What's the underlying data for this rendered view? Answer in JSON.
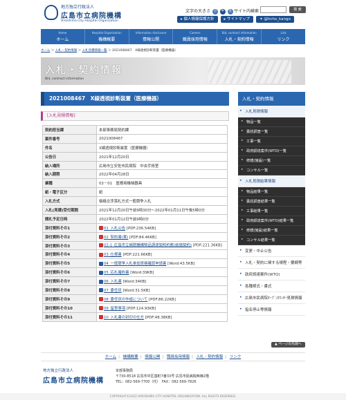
{
  "header": {
    "logo_line1": "地方独立行政法人",
    "logo_line2": "広島市立病院機構",
    "logo_line3": "Hiroshima City Hospital Organization",
    "font_size_label": "文字の大きさ",
    "font_sizes": [
      "小",
      "中",
      "大"
    ],
    "site_search_label": "サイト内検索",
    "search_button": "検 索",
    "buttons": [
      "個人情報保護方針",
      "サイトマップ",
      "@hcho_kango"
    ]
  },
  "gnav": [
    {
      "en": "Home",
      "jp": "ホーム"
    },
    {
      "en": "Hospital Organization",
      "jp": "機構概要"
    },
    {
      "en": "Information disclosure",
      "jp": "情報公開"
    },
    {
      "en": "Careers",
      "jp": "職員採用情報"
    },
    {
      "en": "Bid, contract information",
      "jp": "入札・契約情報"
    },
    {
      "en": "Link",
      "jp": "リンク"
    }
  ],
  "breadcrumb": {
    "items": [
      "ホーム",
      "入札・契約情報",
      "入札見積情報一覧"
    ],
    "current": "2021008467　X線透視診断装置（医療機器）"
  },
  "banner": {
    "title": "入札・契約情報",
    "subtitle": "Bid, contract information"
  },
  "page_title": "2021008467　X線透視診断装置（医療機器）",
  "section_title": "[入札見積情報]",
  "details": [
    {
      "key": "契約担当課",
      "value": "本部事務局契約課"
    },
    {
      "key": "案件番号",
      "value": "2021008467"
    },
    {
      "key": "件名",
      "value": "X線透視診断装置（医療機器）"
    },
    {
      "key": "公告日",
      "value": "2021年12月20日"
    },
    {
      "key": "納入場所",
      "value": "広島市立安佐市民病院　中央手術室"
    },
    {
      "key": "納入期限",
      "value": "2022年04月28日"
    },
    {
      "key": "業種",
      "value": "03－01　医療用機械器具"
    },
    {
      "key": "紙・電子区分",
      "value": "紙"
    },
    {
      "key": "入札方式",
      "value": "価格交渉落札方式一般競争入札"
    },
    {
      "key": "入札(見積)受付期間",
      "value": "2021年12月20日午前9時30分～2022年01月11日午後5時0分"
    },
    {
      "key": "開札予定日時",
      "value": "2022年01月12日午前9時0分"
    }
  ],
  "attachments": [
    {
      "key": "添付資料その1",
      "type": "pdf",
      "link": "01_入札公告",
      "meta": "[PDF:236.54KB]"
    },
    {
      "key": "添付資料その2",
      "type": "pdf",
      "link": "02_契約書(案)",
      "meta": "[PDF:84.46KB]"
    },
    {
      "key": "添付資料その3",
      "type": "pdf",
      "link": "02-1_広島市立病院機構物品調達契約約款(総価契約)",
      "meta": "[PDF:221.36KB]"
    },
    {
      "key": "添付資料その4",
      "type": "pdf",
      "link": "03_仕様書",
      "meta": "[PDF:221.66KB]"
    },
    {
      "key": "添付資料その5",
      "type": "doc",
      "link": "04_一般競争入札参加資格確認申請書",
      "meta": "[Word:43.5KB]"
    },
    {
      "key": "添付資料その6",
      "type": "doc",
      "link": "05_応札確約書",
      "meta": "[Word:39KB]"
    },
    {
      "key": "添付資料その7",
      "type": "doc",
      "link": "06_入札書",
      "meta": "[Word:34KB]"
    },
    {
      "key": "添付資料その8",
      "type": "doc",
      "link": "07_委任状",
      "meta": "[Word:31.5KB]"
    },
    {
      "key": "添付資料その9",
      "type": "pdf",
      "link": "08_委任状の作成について",
      "meta": "[PDF:86.22KB]"
    },
    {
      "key": "添付資料その10",
      "type": "pdf",
      "link": "09_留意事項",
      "meta": "[PDF:124.93KB]"
    },
    {
      "key": "添付資料その11",
      "type": "pdf",
      "link": "10_入札書の封印の仕方",
      "meta": "[PDF:48.38KB]"
    }
  ],
  "sidebar": {
    "title": "入札・契約情報",
    "items": [
      {
        "label": "入札見積情報",
        "active": true,
        "subs": [
          "物品一覧",
          "委託調査一覧",
          "工事一覧",
          "政府調達案件(WTO)一覧",
          "修繕(施設)一覧",
          "コンサル一覧"
        ]
      },
      {
        "label": "入札見積結果情報",
        "active": true,
        "subs": [
          "物品結果一覧",
          "委託調査結果一覧",
          "工事結果一覧",
          "政府調達案件(WTO)結果一覧",
          "修繕(施設)結果一覧",
          "コンサル結果一覧"
        ]
      },
      {
        "label": "変更・中止公告",
        "active": false,
        "subs": []
      },
      {
        "label": "入札・契約に関する規程・要綱等",
        "active": false,
        "subs": []
      },
      {
        "label": "政府調達案件(WTO)",
        "active": false,
        "subs": []
      },
      {
        "label": "各種様式・書式",
        "active": false,
        "subs": []
      },
      {
        "label": "広島市民病院ｵｰﾌﾟﾝｶｳﾝﾀｰ見積情報",
        "active": false,
        "subs": []
      },
      {
        "label": "指名停止等情報",
        "active": false,
        "subs": []
      }
    ]
  },
  "page_top": "ページの先頭へ",
  "footer_nav": [
    "ホーム",
    "機構概要",
    "情報公開",
    "職員採用情報",
    "入札・契約情報",
    "リンク"
  ],
  "footer": {
    "org_line1": "地方独立行政法人",
    "org_line2": "広島市立病院機構",
    "office": "本部事務局",
    "address": "〒730-8518 広島市中区基町7番33号 広島市民病院西棟2階",
    "tel": "TEL：082-569-7700（代）　FAX：082-569-7826",
    "copyright": "COPYRIGHT©2022 HIROSHIMA CITY HOSPITAL ORGANIZATION. ALL RIGHTS RESERVED."
  }
}
